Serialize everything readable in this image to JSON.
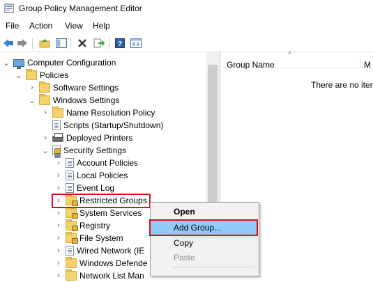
{
  "window": {
    "title": "Group Policy Management Editor"
  },
  "menu": [
    "File",
    "Action",
    "View",
    "Help"
  ],
  "toolbar": {
    "buttons": [
      "back-icon",
      "forward-icon",
      "up-folder-icon",
      "show-hide-tree-icon",
      "delete-icon",
      "export-list-icon",
      "help-icon",
      "properties-icon"
    ]
  },
  "tree": {
    "items": [
      {
        "label": "Computer Configuration",
        "icon": "computer-icon",
        "expanded": true
      },
      {
        "label": "Policies",
        "icon": "folder-icon",
        "expanded": true
      },
      {
        "label": "Software Settings",
        "icon": "folder-icon",
        "expanded": false
      },
      {
        "label": "Windows Settings",
        "icon": "folder-icon",
        "expanded": true
      },
      {
        "label": "Name Resolution Policy",
        "icon": "folder-icon",
        "expanded": false
      },
      {
        "label": "Scripts (Startup/Shutdown)",
        "icon": "script-doc-icon"
      },
      {
        "label": "Deployed Printers",
        "icon": "printer-icon",
        "expanded": false
      },
      {
        "label": "Security Settings",
        "icon": "security-settings-icon",
        "expanded": true
      },
      {
        "label": "Account Policies",
        "icon": "policy-doc-icon",
        "expanded": false
      },
      {
        "label": "Local Policies",
        "icon": "policy-doc-icon",
        "expanded": false
      },
      {
        "label": "Event Log",
        "icon": "policy-doc-icon",
        "expanded": false
      },
      {
        "label": "Restricted Groups",
        "icon": "locked-folder-icon",
        "expanded": false,
        "selected": true
      },
      {
        "label": "System Services",
        "icon": "locked-folder-icon",
        "expanded": false
      },
      {
        "label": "Registry",
        "icon": "locked-folder-icon",
        "expanded": false
      },
      {
        "label": "File System",
        "icon": "locked-folder-icon",
        "expanded": false
      },
      {
        "label": "Wired Network (IE",
        "icon": "network-icon",
        "expanded": false
      },
      {
        "label": "Windows Defende",
        "icon": "folder-icon",
        "expanded": false
      },
      {
        "label": "Network List Man",
        "icon": "folder-icon",
        "expanded": false
      }
    ]
  },
  "list": {
    "columns": [
      "Group Name",
      "M"
    ],
    "empty_text": "There are no item"
  },
  "context_menu": {
    "items": [
      {
        "label": "Open",
        "bold": true
      },
      {
        "label": "Add Group...",
        "highlighted": true
      },
      {
        "label": "Copy"
      },
      {
        "label": "Paste",
        "disabled": true
      }
    ]
  },
  "colors": {
    "highlight_outline": "#d4121a",
    "menu_highlight": "#91c9f7"
  }
}
